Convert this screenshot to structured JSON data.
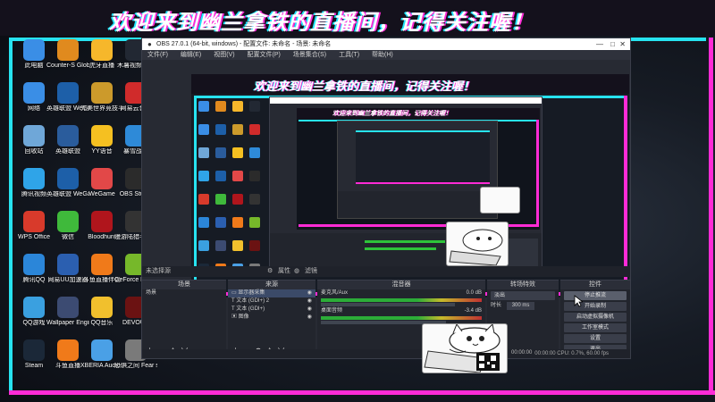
{
  "banner": {
    "text": "欢迎来到幽兰拿铁的直播间，记得关注喔！"
  },
  "desktop": {
    "icons": [
      {
        "label": "此电脑",
        "color": "#3a8ee6"
      },
      {
        "label": "Counter-S Global Off",
        "color": "#e08a1e"
      },
      {
        "label": "虎牙直播",
        "color": "#f6b72b"
      },
      {
        "label": "木薯视频助手",
        "color": "#222833"
      },
      {
        "label": "网络",
        "color": "#3a8ee6"
      },
      {
        "label": "英雄联盟 WeGame版",
        "color": "#1d5fa8"
      },
      {
        "label": "完美世界竞技平台",
        "color": "#cc9a2b"
      },
      {
        "label": "网易云音乐",
        "color": "#d02b2b"
      },
      {
        "label": "回收站",
        "color": "#6fa7d8"
      },
      {
        "label": "英雄联盟",
        "color": "#2a5c9c"
      },
      {
        "label": "YY语音",
        "color": "#f5c021"
      },
      {
        "label": "暴雪战网",
        "color": "#2e8ad8"
      },
      {
        "label": "腾讯视频",
        "color": "#2fa4e8"
      },
      {
        "label": "英雄联盟 WeGame版",
        "color": "#1d5fa8"
      },
      {
        "label": "WeGame",
        "color": "#e24848"
      },
      {
        "label": "OBS Studio",
        "color": "#2b2b2b"
      },
      {
        "label": "WPS Office",
        "color": "#d83a2b"
      },
      {
        "label": "微信",
        "color": "#3fb93b"
      },
      {
        "label": "Bloodhunt",
        "color": "#b0151c"
      },
      {
        "label": "漫游陆猎手代码手",
        "color": "#333333"
      },
      {
        "label": "腾讯QQ",
        "color": "#2b86d9"
      },
      {
        "label": "网易UU加速器",
        "color": "#2b5fb0"
      },
      {
        "label": "斗鱼直播伴侣",
        "color": "#f07a1a"
      },
      {
        "label": "GeForce Experience",
        "color": "#76b82a"
      },
      {
        "label": "QQ游戏",
        "color": "#3aa0e0"
      },
      {
        "label": "Wallpaper Engine:",
        "color": "#3c4b72"
      },
      {
        "label": "QQ音乐",
        "color": "#f1c02d"
      },
      {
        "label": "DEVOUR",
        "color": "#6b1212"
      },
      {
        "label": "Steam",
        "color": "#1b2838"
      },
      {
        "label": "斗鱼直播",
        "color": "#f07a1a"
      },
      {
        "label": "XBERIA Audio...",
        "color": "#4aa0e6"
      },
      {
        "label": "恐惧之间 Fear sur...",
        "color": "#7a7a7a"
      }
    ]
  },
  "obs": {
    "title": "OBS 27.0.1 (64-bit, windows) - 配置文件: 未命名 - 场景: 未命名",
    "menu": [
      "文件(F)",
      "编辑(E)",
      "视图(V)",
      "配置文件(P)",
      "场景集合(S)",
      "工具(T)",
      "帮助(H)"
    ],
    "scenebar": "未选择源",
    "scenebar_buttons": [
      "属性",
      "滤镜"
    ],
    "panels": {
      "scenes": {
        "title": "场景",
        "items": [
          "场景"
        ]
      },
      "sources": {
        "title": "来源",
        "items": [
          "显示器采集",
          "文本 (GDI+) 2",
          "文本 (GDI+)",
          "图像"
        ]
      },
      "mixer": {
        "title": "混音器",
        "tracks": [
          {
            "name": "麦克风/Aux",
            "db": "0.0 dB"
          },
          {
            "name": "桌面音频",
            "db": "-3.4 dB"
          }
        ]
      },
      "transitions": {
        "title": "转场特效",
        "type": "淡出",
        "duration_label": "时长",
        "duration": "300 ms"
      },
      "controls": {
        "title": "控件",
        "buttons": [
          "停止推流",
          "开始录制",
          "启动虚拟摄像机",
          "工作室模式",
          "设置",
          "退出"
        ]
      }
    },
    "status": "00:00:00   CPU: 0.7%, 60.00 fps",
    "live_time": "00:00:00"
  }
}
